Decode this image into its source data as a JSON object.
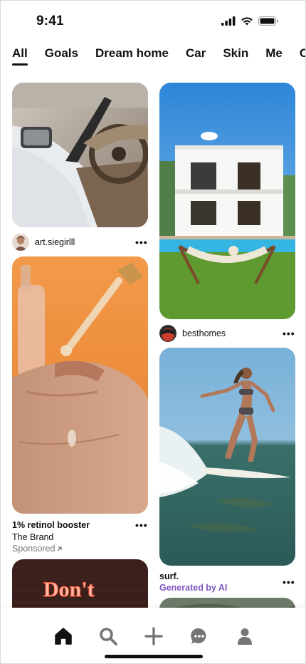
{
  "status_bar": {
    "time": "9:41"
  },
  "tabs": [
    {
      "label": "All",
      "active": true
    },
    {
      "label": "Goals"
    },
    {
      "label": "Dream home"
    },
    {
      "label": "Car"
    },
    {
      "label": "Skin"
    },
    {
      "label": "Me"
    },
    {
      "label": "Co"
    }
  ],
  "pins": {
    "car": {
      "author": "art.siegirlll",
      "more": "•••"
    },
    "house": {
      "author": "besthomes",
      "more": "•••"
    },
    "serum": {
      "title": "1% retinol booster",
      "brand": "The Brand",
      "sponsored": "Sponsored",
      "more": "•••"
    },
    "surf": {
      "title": "surf.",
      "ai_label": "Generated by AI",
      "more": "•••"
    },
    "neon": {
      "text": "Don't"
    }
  },
  "nav": {
    "items": [
      "home",
      "search",
      "create",
      "messages",
      "profile"
    ]
  },
  "colors": {
    "accent_ai": "#7e57c2",
    "muted": "#767676",
    "text": "#111111"
  }
}
